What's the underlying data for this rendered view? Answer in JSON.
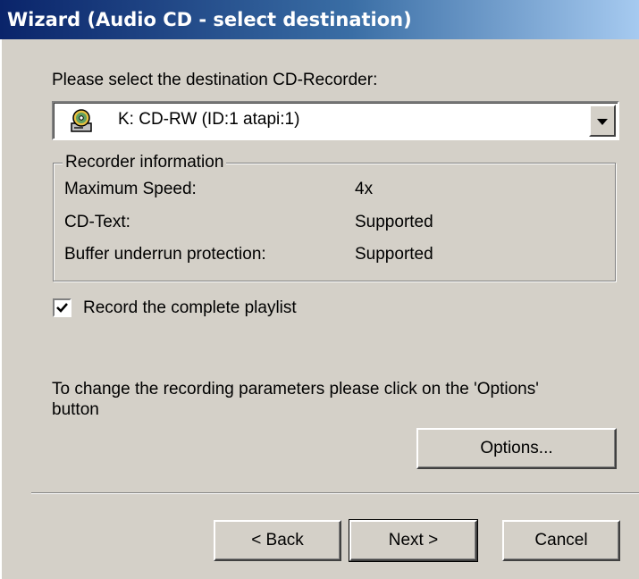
{
  "window": {
    "title": "Wizard (Audio CD - select destination)"
  },
  "prompt": "Please select the destination CD-Recorder:",
  "recorder_select": {
    "selected": "K: CD-RW (ID:1 atapi:1)",
    "icon": "cd-drive-icon"
  },
  "recorder_info": {
    "legend": "Recorder information",
    "rows": [
      {
        "label": "Maximum Speed:",
        "value": "4x"
      },
      {
        "label": "CD-Text:",
        "value": "Supported"
      },
      {
        "label": "Buffer underrun protection:",
        "value": "Supported"
      }
    ]
  },
  "record_playlist": {
    "label": "Record the complete playlist",
    "checked": true
  },
  "hint": {
    "line1": "To change the recording parameters please click on the 'Options'",
    "line2": "button"
  },
  "buttons": {
    "options": "Options...",
    "back": "< Back",
    "next": "Next >",
    "cancel": "Cancel"
  }
}
